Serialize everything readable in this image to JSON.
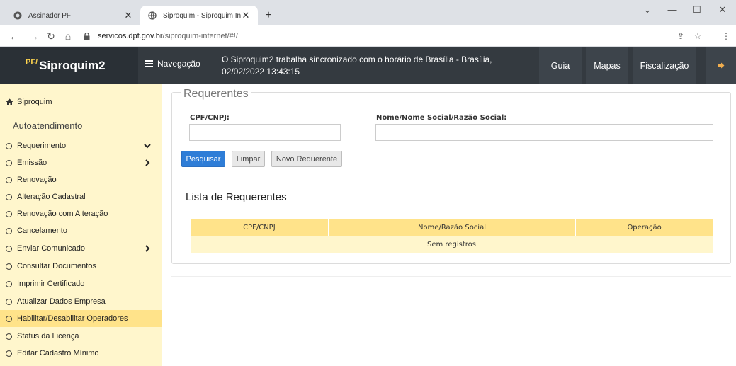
{
  "browser": {
    "tabs": [
      {
        "title": "Assinador PF",
        "active": false
      },
      {
        "title": "Siproquim - Siproquim Internet",
        "active": true
      }
    ],
    "url_host": "servicos.dpf.gov.br",
    "url_path": "/siproquim-internet/#!/"
  },
  "header": {
    "brand_prefix": "PF/",
    "brand_name": "Siproquim2",
    "nav_label": "Navegação",
    "message_line1": "O Siproquim2 trabalha sincronizado com o horário de Brasília - Brasília,",
    "message_line2": "02/02/2022 13:43:15",
    "buttons": {
      "guia": "Guia",
      "mapas": "Mapas",
      "fiscalizacao": "Fiscalização"
    }
  },
  "sidebar": {
    "home": "Siproquim",
    "section": "Autoatendimento",
    "items": [
      {
        "label": "Requerimento",
        "chevron": "down"
      },
      {
        "label": "Emissão",
        "chevron": "right"
      },
      {
        "label": "Renovação"
      },
      {
        "label": "Alteração Cadastral"
      },
      {
        "label": "Renovação com Alteração"
      },
      {
        "label": "Cancelamento"
      },
      {
        "label": "Enviar Comunicado",
        "chevron": "right"
      },
      {
        "label": "Consultar Documentos"
      },
      {
        "label": "Imprimir Certificado"
      },
      {
        "label": "Atualizar Dados Empresa"
      },
      {
        "label": "Habilitar/Desabilitar Operadores",
        "active": true
      },
      {
        "label": "Status da Licença"
      },
      {
        "label": "Editar Cadastro Mínimo"
      }
    ]
  },
  "main": {
    "legend": "Requerentes",
    "cpf_label": "CPF/CNPJ:",
    "cpf_value": "",
    "nome_label": "Nome/Nome Social/Razão Social:",
    "nome_value": "",
    "buttons": {
      "pesquisar": "Pesquisar",
      "limpar": "Limpar",
      "novo": "Novo Requerente"
    },
    "list_title": "Lista de Requerentes",
    "table": {
      "headers": [
        "CPF/CNPJ",
        "Nome/Razão Social",
        "Operação"
      ],
      "empty": "Sem registros"
    }
  },
  "colors": {
    "header_bg": "#343a40",
    "sidebar_bg": "#fff6cc",
    "sidebar_active": "#ffe38a",
    "primary": "#2e7dd7"
  }
}
